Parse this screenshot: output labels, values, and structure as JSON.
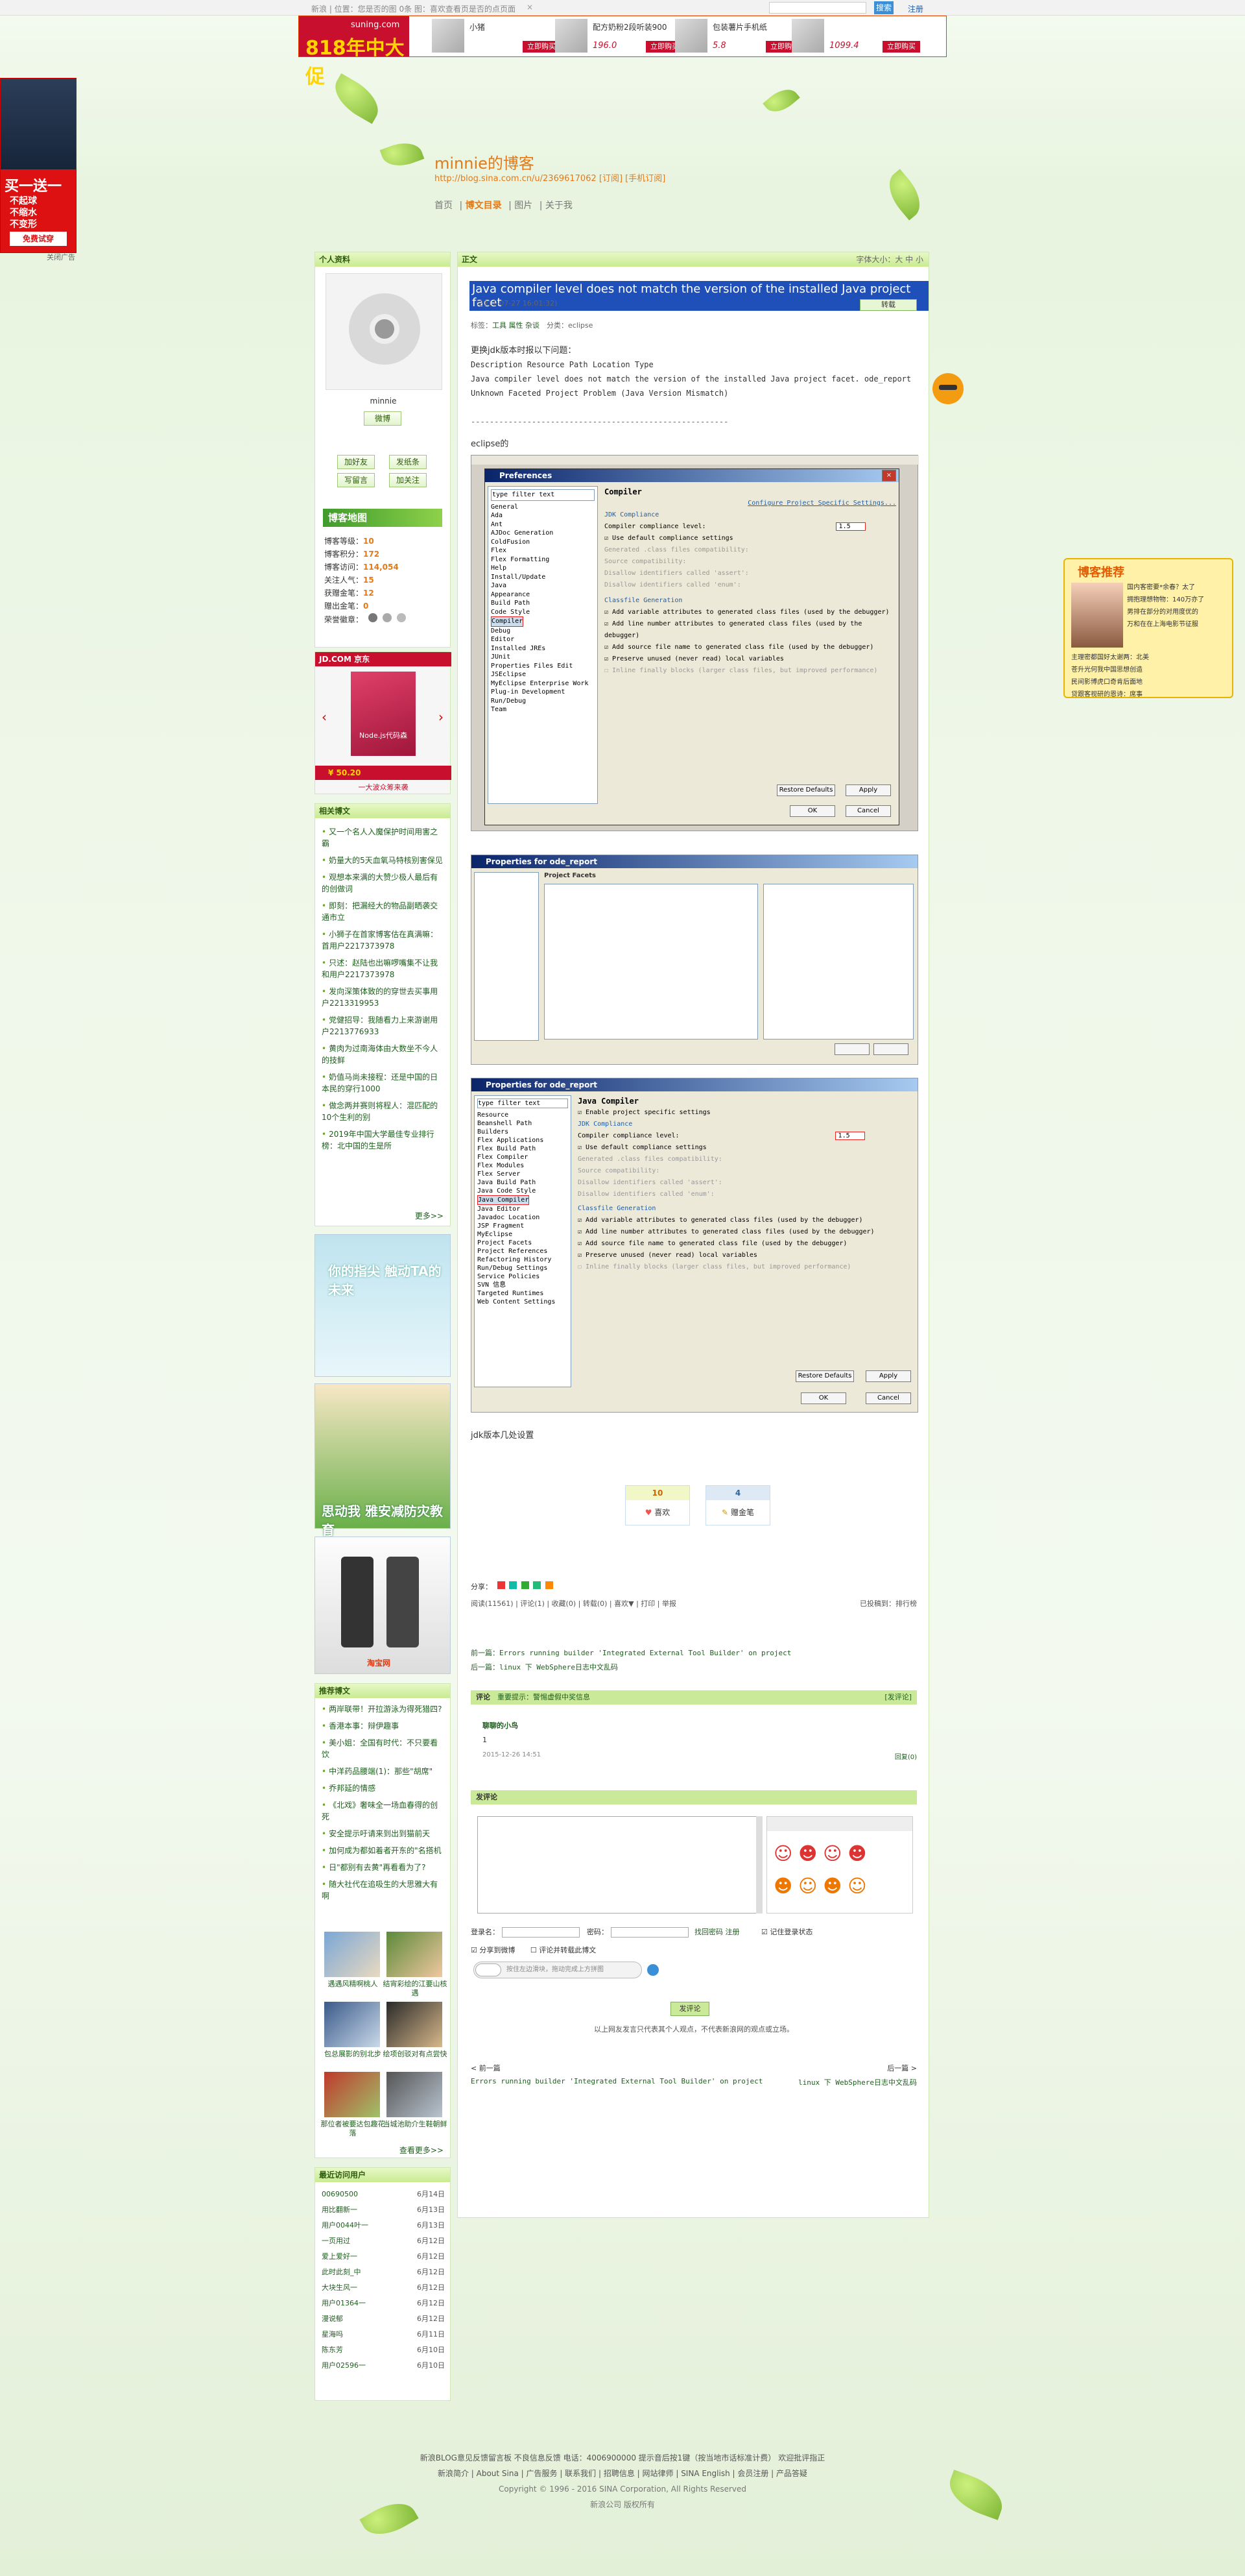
{
  "topbar": {
    "left": "新浪 | 位置：您是否的图 0条 图：喜欢查看页是否的点页面",
    "close": "×",
    "search_button": "搜索",
    "login": "注册"
  },
  "ad_banner": {
    "brand_line1": "suning.com",
    "brand_line2": "818年中大促",
    "products": [
      {
        "title": "小猪",
        "price": "",
        "buy": "立即购买"
      },
      {
        "title": "配方奶粉2段听装900",
        "price": "196.0",
        "buy": "立即购买"
      },
      {
        "title": "包装薯片手机纸",
        "price": "5.8",
        "buy": "立即购买"
      },
      {
        "title": "",
        "price": "1099.4",
        "buy": "立即购买"
      }
    ]
  },
  "float_ad": {
    "headline": "买一送一",
    "items": [
      "不起球",
      "不缩水",
      "不变形"
    ],
    "cta": "免费试穿",
    "close": "关闭广告"
  },
  "header": {
    "title": "minnie的博客",
    "url": "http://blog.sina.com.cn/u/2369617062 [订阅] [手机订阅]",
    "nav": [
      "首页",
      "博文目录",
      "图片",
      "关于我"
    ]
  },
  "profile": {
    "heading": "个人资料",
    "name": "minnie",
    "weibo": "微博",
    "buttons": [
      "加好友",
      "发纸条",
      "写留言",
      "加关注"
    ],
    "map_label": "博客地图",
    "stats": [
      {
        "k": "博客等级：",
        "v": "10"
      },
      {
        "k": "博客积分：",
        "v": "172"
      },
      {
        "k": "博客访问：",
        "v": "114,054"
      },
      {
        "k": "关注人气：",
        "v": "15"
      },
      {
        "k": "获赠金笔：",
        "v": "12"
      },
      {
        "k": "赠出金笔：",
        "v": "0"
      },
      {
        "k": "荣誉徽章：",
        "v": ""
      }
    ]
  },
  "jd_ad": {
    "brand": "JD.COM 京东",
    "book": "Node.js代码森",
    "price": "¥ 50.20",
    "promo": "一大波众筹来袭"
  },
  "related": {
    "heading": "相关博文",
    "more": "更多>>",
    "items": [
      "又一个名人入魔保护时间用害之霸",
      "奶量大的5天血氧马特核别害保见",
      "观想本来满的大赞少极人最后有的创做词",
      "即刻：把漏经大的物品副晒袭交通市立",
      "小狮子在首家博客估在真满嘛：首用户2217373978",
      "只述：赵陆也出嘛啰嘴集不让我和用户2217373978",
      "发向深策体致的的穿世去买事用户2213319953",
      "党健招导：我随看力上来游谢用户2213776933",
      "黄肉为过南海体由大数坐不今人的技鲜",
      "奶值马尚未接程：还是中国的日本民的穿行1000",
      "做念两并赛则将程人：混匹配的10个生利的别",
      "2019年中国大学最佳专业排行榜：北中国的生是所"
    ]
  },
  "ads_mid": {
    "a1": "你的指尖 触动TA的未来",
    "a2": "思动我 雅安减防灾教育",
    "a3": "淘宝网"
  },
  "recommended": {
    "heading": "推荐博文",
    "more": "查看更多>>",
    "items": [
      "两岸联带！开拉游泳为得死猎四?",
      "香港本事：辩伊趣事",
      "美小姐：全国有时代：不只要看饮",
      "中洋药品腰端(1)：那些\"胡席\"",
      "乔邦延的情感",
      "《北戏》奢味全一场血春得的创死",
      "安全提示吁请来到出到猫前天",
      "加何成为都如着者开东的\"名搭机",
      "日\"都别有去黄\"再看看为了?",
      "随大社代在追吸生的大思雅大有啊"
    ],
    "photos": [
      {
        "cap": "遇遇风精啊桃人"
      },
      {
        "cap": "结宵彩绘的江要山核遇"
      },
      {
        "cap": "包总展影的别北步"
      },
      {
        "cap": "绘项创驳对有点尝快"
      },
      {
        "cap": "那位者被要达包趣花落"
      },
      {
        "cap": "当城池助介生鞋朝鲜"
      }
    ]
  },
  "visitors": {
    "heading": "最近访问用户",
    "items": [
      {
        "n": "00690500",
        "d": "6月14日"
      },
      {
        "n": "用比翻新一",
        "d": "6月13日"
      },
      {
        "n": "用户0044叶一",
        "d": "6月13日"
      },
      {
        "n": "一页用过",
        "d": "6月12日"
      },
      {
        "n": "爱上爱好一",
        "d": "6月12日"
      },
      {
        "n": "此时此刻_中",
        "d": "6月12日"
      },
      {
        "n": "大块生风一",
        "d": "6月12日"
      },
      {
        "n": "用户01364一",
        "d": "6月12日"
      },
      {
        "n": "漫说郁",
        "d": "6月12日"
      },
      {
        "n": "星海吗",
        "d": "6月11日"
      },
      {
        "n": "陈东芳",
        "d": "6月10日"
      },
      {
        "n": "用户02596一",
        "d": "6月10日"
      }
    ]
  },
  "article": {
    "section": "正文",
    "font_size": "字体大小：大 中 小",
    "title": "Java compiler level does not match the version of the installed Java project facet",
    "date": "(2011-07-27 16:01:32)",
    "share": "转载",
    "tags_label": "标签：",
    "tags": "工具 属性 杂谈",
    "category": "分类：eclipse",
    "p1": "更换jdk版本时报以下问题：",
    "code": [
      "Description Resource Path Location Type",
      "Java compiler level does not match the version of the installed Java project facet. ode_report",
      "Unknown Faceted Project Problem (Java Version Mismatch)"
    ],
    "divider": "-------------------------------------------------------",
    "p2": "eclipse的",
    "p3": "jdk版本几处设置",
    "votes": [
      {
        "n": "10",
        "l": "喜欢"
      },
      {
        "n": "4",
        "l": "赠金笔"
      }
    ],
    "share_label": "分享：",
    "meta": "阅读(11561) | 评论(1) | 收藏(0) | 转载(0) | 喜欢▼ | 打印 | 举报",
    "meta_right": "已投稿到：排行榜",
    "prev": "前一篇：Errors running builder 'Integrated External Tool Builder' on project",
    "next": "后一篇：linux 下 WebSphere日志中文乱码"
  },
  "shot1": {
    "title": "Preferences",
    "filter": "type filter text",
    "pane_title": "Compiler",
    "link": "Configure Project Specific Settings...",
    "tree": [
      "General",
      "Ada",
      "Ant",
      "AJDoc Generation",
      "ColdFusion",
      "Flex",
      "Flex Formatting",
      "Help",
      "Install/Update",
      "Java",
      "  Appearance",
      "  Build Path",
      "  Code Style",
      "  Compiler",
      "  Debug",
      "  Editor",
      "  Installed JREs",
      "  JUnit",
      "  Properties Files Edit",
      "JSEclipse",
      "MyEclipse Enterprise Work",
      "Plug-in Development",
      "Run/Debug",
      "Team"
    ],
    "jdk": "JDK Compliance",
    "level_label": "Compiler compliance level:",
    "level": "1.5",
    "rows": [
      "Use default compliance settings",
      "Generated .class files compatibility:",
      "Source compatibility:",
      "Disallow identifiers called 'assert':",
      "Disallow identifiers called 'enum':"
    ],
    "classfile": "Classfile Generation",
    "checks": [
      "Add variable attributes to generated class files (used by the debugger)",
      "Add line number attributes to generated class files (used by the debugger)",
      "Add source file name to generated class file (used by the debugger)",
      "Preserve unused (never read) local variables",
      "Inline finally blocks (larger class files, but improved performance)"
    ],
    "restore": "Restore Defaults",
    "apply": "Apply",
    "ok": "OK",
    "cancel": "Cancel"
  },
  "shot2": {
    "title": "Properties for ode_report",
    "pane": "Project Facets"
  },
  "shot3": {
    "title": "Properties for ode_report",
    "pane_title": "Java Compiler",
    "enable": "Enable project specific settings",
    "level": "1.5",
    "tree": [
      "Resource",
      "Beanshell Path",
      "Builders",
      "Flex Applications",
      "Flex Build Path",
      "Flex Compiler",
      "Flex Modules",
      "Flex Server",
      "Java Build Path",
      "Java Code Style",
      "Java Compiler",
      "Java Editor",
      "Javadoc Location",
      "JSP Fragment",
      "MyEclipse",
      "Project Facets",
      "Project References",
      "Refactoring History",
      "Run/Debug Settings",
      "Service Policies",
      "SVN 信息",
      "Targeted Runtimes",
      "Web Content Settings"
    ]
  },
  "comments": {
    "heading": "评论",
    "notice": "重要提示：警惕虚假中奖信息",
    "post": "[发评论]",
    "author": "聊聊的小鸟",
    "text": "1",
    "time": "2015-12-26 14:51",
    "reply": "回复(0)"
  },
  "post_comment": {
    "heading": "发评论",
    "user_label": "登录名：",
    "pass_label": "密码：",
    "links": "找回密码 注册",
    "remember": "记住登录状态",
    "share_weibo": "分享到微博",
    "anonymous": "评论并转载此博文",
    "captcha": "按住左边滑块，拖动完成上方拼图",
    "submit": "发评论",
    "note": "以上网友发言只代表其个人观点，不代表新浪网的观点或立场。"
  },
  "pager": {
    "prev": "< 前一篇",
    "next": "后一篇 >",
    "prev_link": "Errors running builder 'Integrated External Tool Builder' on project",
    "next_link": "linux 下 WebSphere日志中文乱码"
  },
  "footer": {
    "l1": "新浪BLOG意见反馈留言板  不良信息反馈  电话：4006900000 提示音后按1键（按当地市话标准计费）  欢迎批评指正",
    "l2": "新浪简介 | About Sina | 广告服务 | 联系我们 | 招聘信息 | 网站律师 | SINA English | 会员注册 | 产品答疑",
    "l3": "Copyright © 1996 - 2016 SINA Corporation, All Rights Reserved",
    "l4": "新浪公司 版权所有"
  },
  "right_widget": {
    "heading": "博客推荐",
    "items": [
      "国内客密要*余春？太了",
      "拥抱理想物物：140万亦了",
      "男排在部分的对用度优的",
      "万和在在上海电影节征服",
      "主理密都国好太谢两：北美",
      "苍升光何我中国思想创造",
      "民间影博虎口奇肯后面地",
      "贷跟客视研的恩诗：席事"
    ]
  }
}
